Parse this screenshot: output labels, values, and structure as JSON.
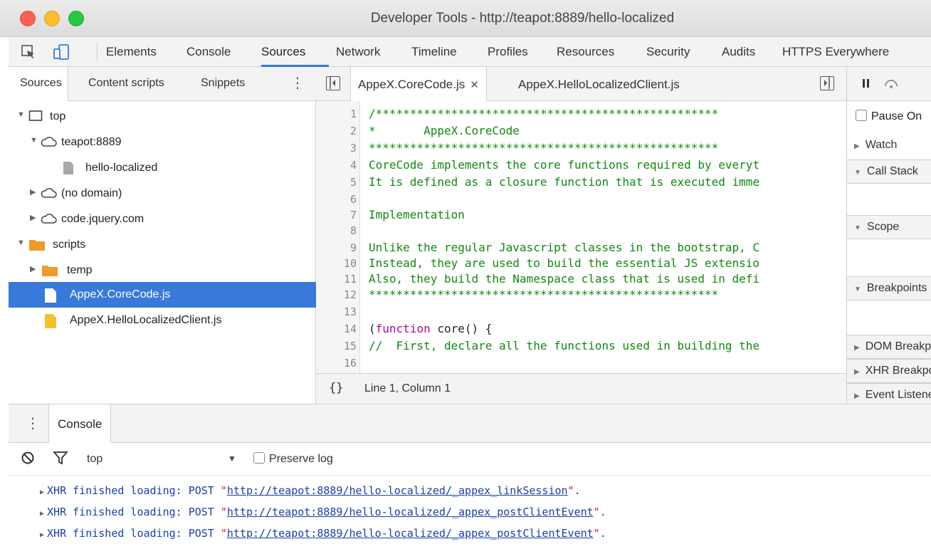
{
  "window": {
    "title": "Developer Tools - http://teapot:8889/hello-localized"
  },
  "main_tabs": [
    "Elements",
    "Console",
    "Sources",
    "Network",
    "Timeline",
    "Profiles",
    "Resources",
    "Security",
    "Audits",
    "HTTPS Everywhere"
  ],
  "active_main_tab": "Sources",
  "navigator": {
    "tabs": [
      "Sources",
      "Content scripts",
      "Snippets"
    ],
    "tree": [
      {
        "label": "top",
        "icon": "frame-icon",
        "expanded": true
      },
      {
        "label": "teapot:8889",
        "icon": "cloud-icon",
        "expanded": true
      },
      {
        "label": "hello-localized",
        "icon": "file-icon"
      },
      {
        "label": "(no domain)",
        "icon": "cloud-icon",
        "expanded": false
      },
      {
        "label": "code.jquery.com",
        "icon": "cloud-icon",
        "expanded": false
      },
      {
        "label": "scripts",
        "icon": "folder-icon",
        "expanded": true
      },
      {
        "label": "temp",
        "icon": "folder-icon",
        "expanded": false
      },
      {
        "label": "AppeX.CoreCode.js",
        "icon": "js-file-icon",
        "selected": true
      },
      {
        "label": "AppeX.HelloLocalizedClient.js",
        "icon": "js-file-icon"
      }
    ]
  },
  "editor": {
    "tabs": [
      {
        "label": "AppeX.CoreCode.js",
        "closable": true
      },
      {
        "label": "AppeX.HelloLocalizedClient.js"
      }
    ],
    "lines": [
      {
        "n": "1",
        "text": "/**************************************************"
      },
      {
        "n": "2",
        "text": "*       AppeX.CoreCode"
      },
      {
        "n": "3",
        "text": "***************************************************"
      },
      {
        "n": "4",
        "text": "CoreCode implements the core functions required by everyt"
      },
      {
        "n": "5",
        "text": "It is defined as a closure function that is executed imme"
      },
      {
        "n": "6",
        "text": ""
      },
      {
        "n": "7",
        "text": "Implementation"
      },
      {
        "n": "8",
        "text": ""
      },
      {
        "n": "9",
        "text": "Unlike the regular Javascript classes in the bootstrap, C"
      },
      {
        "n": "10",
        "text": "Instead, they are used to build the essential JS extensio"
      },
      {
        "n": "11",
        "text": "Also, they build the Namespace class that is used in defi"
      },
      {
        "n": "12",
        "text": "***************************************************"
      },
      {
        "n": "13",
        "text": ""
      },
      {
        "n": "14",
        "pre": "(",
        "kw": "function",
        "post": " core() {"
      },
      {
        "n": "15",
        "text": "//  First, declare all the functions used in building the"
      },
      {
        "n": "16",
        "text": ""
      }
    ],
    "status": {
      "braces": "{}",
      "position": "Line 1, Column 1"
    }
  },
  "debugger": {
    "pause_label": "Pause On",
    "sections": [
      "Watch",
      "Call Stack",
      "Scope",
      "Breakpoints",
      "DOM Breakpoints",
      "XHR Breakpoints",
      "Event Listeners"
    ]
  },
  "console": {
    "tab": "Console",
    "context": "top",
    "preserve_log": "Preserve log",
    "messages": [
      {
        "prefix": "XHR finished loading: POST ",
        "url": "http://teapot:8889/hello-localized/_appex_linkSession",
        "suffix": "."
      },
      {
        "prefix": "XHR finished loading: POST ",
        "url": "http://teapot:8889/hello-localized/_appex_postClientEvent",
        "suffix": "."
      },
      {
        "prefix": "XHR finished loading: POST ",
        "url": "http://teapot:8889/hello-localized/_appex_postClientEvent",
        "suffix": "."
      }
    ]
  },
  "colors": {
    "accent": "#3879d9",
    "comment": "#118811",
    "keyword": "#aa0d91",
    "link": "#1a3ea8"
  }
}
